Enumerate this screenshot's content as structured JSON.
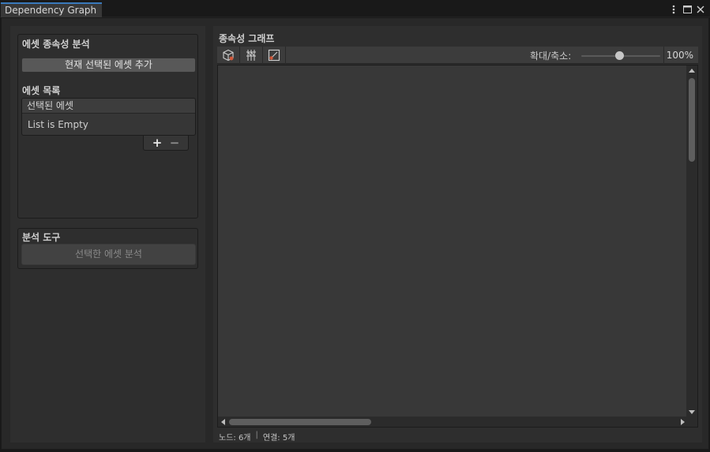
{
  "window": {
    "tab_title": "Dependency Graph"
  },
  "left": {
    "analysis": {
      "title": "에셋 종속성 분석",
      "add_button": "현재 선택된 에셋 추가",
      "list_title": "에셋 목록",
      "list_header": "선택된 에셋",
      "list_empty": "List is Empty",
      "add_item": "+",
      "remove_item": "−"
    },
    "tools": {
      "title": "분석 도구",
      "analyze_button": "선택한 에셋 분석"
    }
  },
  "graph": {
    "title": "종속성 그래프",
    "toolbar": {
      "zoom_label": "확대/축소:",
      "zoom_value": "100%",
      "zoom_level": 1.0
    },
    "status": {
      "nodes": "노드: 6개",
      "separator": "|",
      "edges": "연결: 5개"
    }
  },
  "colors": {
    "tab_accent": "#3a79bb",
    "background": "#282828",
    "panel": "#2e2e2e",
    "canvas": "#383838"
  }
}
